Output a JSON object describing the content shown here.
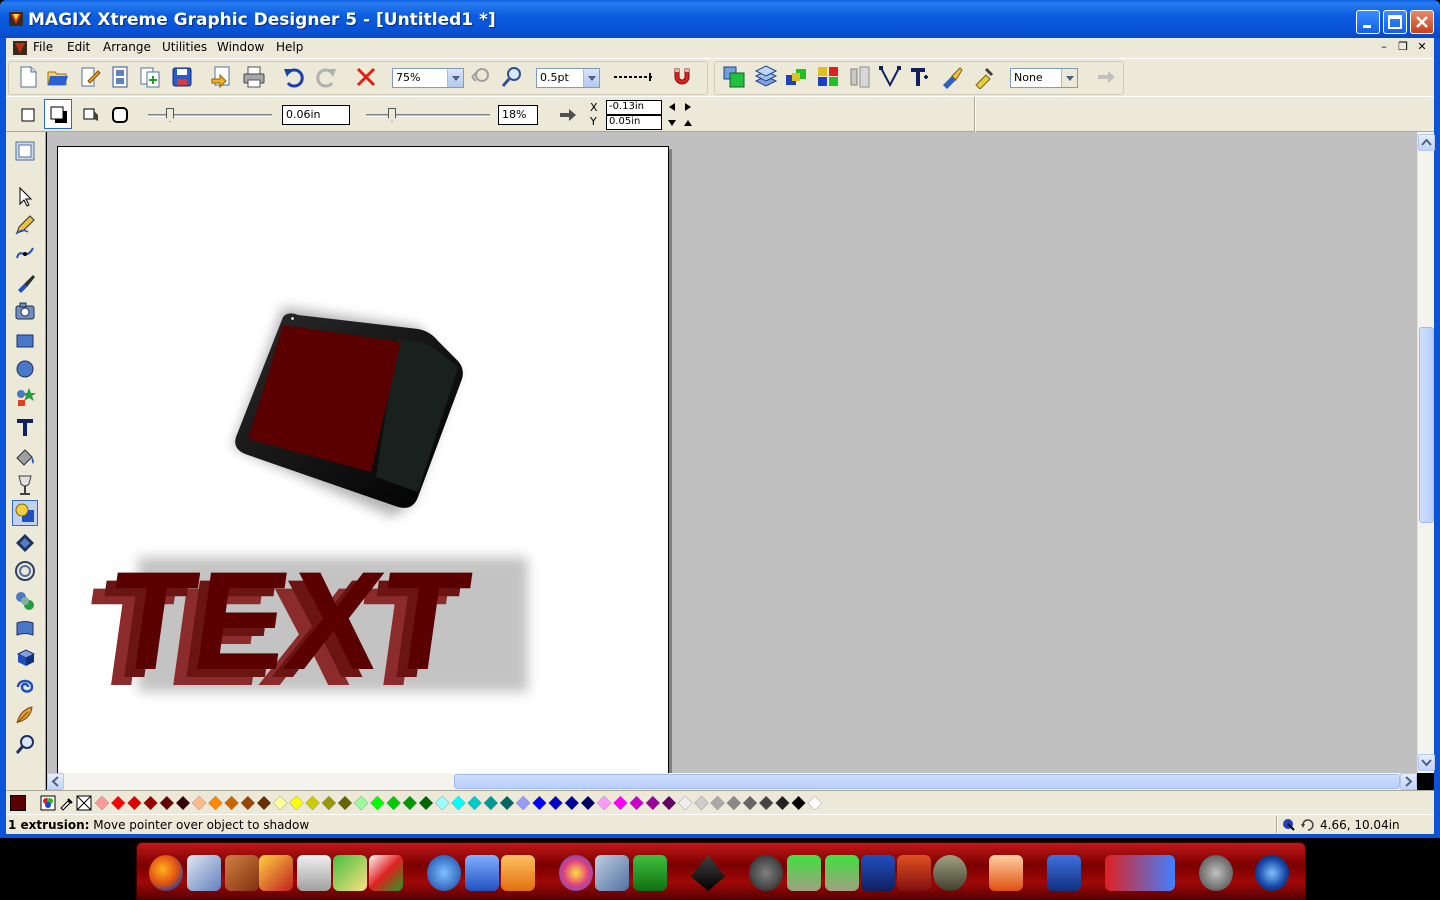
{
  "window": {
    "title": "MAGIX Xtreme Graphic Designer 5 - [Untitled1 *]"
  },
  "menu": {
    "items": [
      "File",
      "Edit",
      "Arrange",
      "Utilities",
      "Window",
      "Help"
    ]
  },
  "toolbar": {
    "zoom": "75%",
    "line_width": "0.5pt",
    "arrowhead": "None"
  },
  "shadow_bar": {
    "blur_value": "0.06in",
    "transparency_value": "18%",
    "x_label": "X",
    "y_label": "Y",
    "x_offset": "-0.13in",
    "y_offset": "0.05in"
  },
  "canvas": {
    "text_object": "TEXT",
    "fill_color": "#5a0000",
    "side_color": "#8b2b2b",
    "box_side_color": "#18211e"
  },
  "palette": {
    "current_color": "#5a0000",
    "swatches": [
      "#ff9999",
      "#ff0000",
      "#dd0000",
      "#990000",
      "#660000",
      "#330000",
      "#ffbb88",
      "#ff8800",
      "#cc6600",
      "#994400",
      "#663300",
      "#ffff99",
      "#ffff00",
      "#cccc00",
      "#999900",
      "#666600",
      "#99ff99",
      "#00ff00",
      "#00cc00",
      "#009900",
      "#006600",
      "#99ffff",
      "#00ffff",
      "#00cccc",
      "#009999",
      "#006666",
      "#9999ff",
      "#0000ff",
      "#0000cc",
      "#000099",
      "#000066",
      "#ff99ff",
      "#ff00ff",
      "#cc00cc",
      "#990099",
      "#660066",
      "#eeeeee",
      "#cccccc",
      "#aaaaaa",
      "#888888",
      "#666666",
      "#444444",
      "#222222",
      "#000000",
      "#ffffff"
    ]
  },
  "status": {
    "bold_part": "1 extrusion:",
    "message": " Move pointer over object to shadow",
    "coords": "4.66, 10.04in"
  }
}
